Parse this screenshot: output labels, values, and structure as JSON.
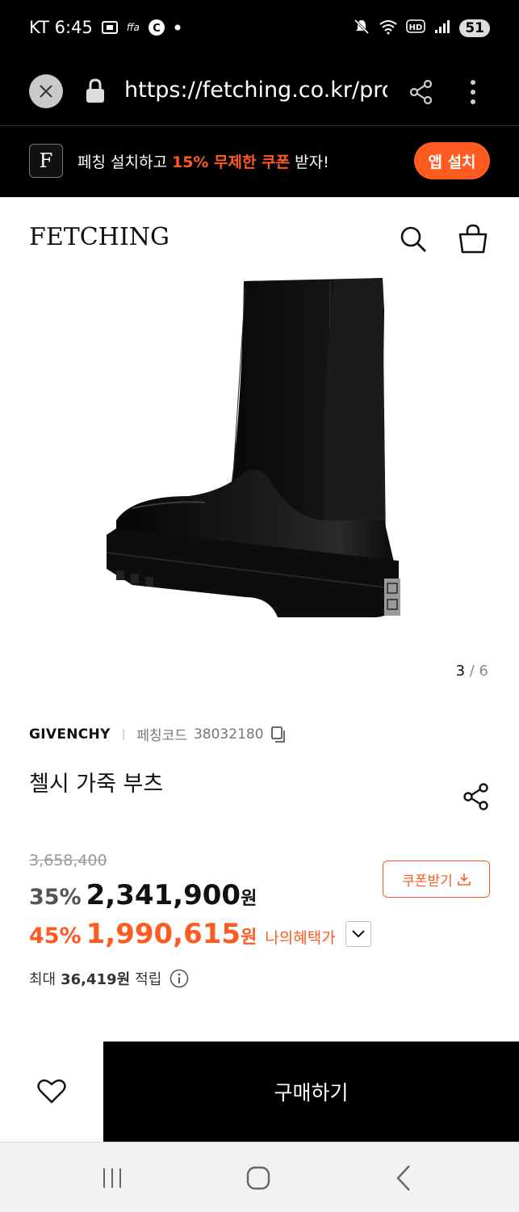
{
  "status_bar": {
    "carrier_time": "KT 6:45",
    "battery": "51",
    "left_icons": [
      "screenshot-icon",
      "ffa-icon",
      "c-circle-icon",
      "dot-icon"
    ],
    "right_icons": [
      "mute-icon",
      "wifi-icon",
      "hd-icon",
      "signal-icon"
    ]
  },
  "browser": {
    "url": "https://fetching.co.kr/pro"
  },
  "app_banner": {
    "logo_letter": "F",
    "text_before": "페칭 설치하고 ",
    "text_highlight": "15% 무제한 쿠폰",
    "text_after": " 받자!",
    "install_label": "앱 설치"
  },
  "header": {
    "logo": "FETCHING"
  },
  "gallery": {
    "current": "3",
    "separator": " / ",
    "total": "6"
  },
  "product": {
    "brand": "GIVENCHY",
    "code_label": "페칭코드",
    "code_value": "38032180",
    "title": "첼시 가죽 부츠",
    "original_price": "3,658,400",
    "discount1": "35%",
    "price1": "2,341,900",
    "won": "원",
    "discount2": "45%",
    "price2": "1,990,615",
    "benefit_label": "나의혜택가",
    "coupon_label": "쿠폰받기",
    "points_prefix": "최대",
    "points_value": "36,419원",
    "points_suffix": "적립"
  },
  "actions": {
    "buy_label": "구매하기"
  },
  "colors": {
    "accent": "#ff5a1f",
    "dark": "#000000"
  }
}
